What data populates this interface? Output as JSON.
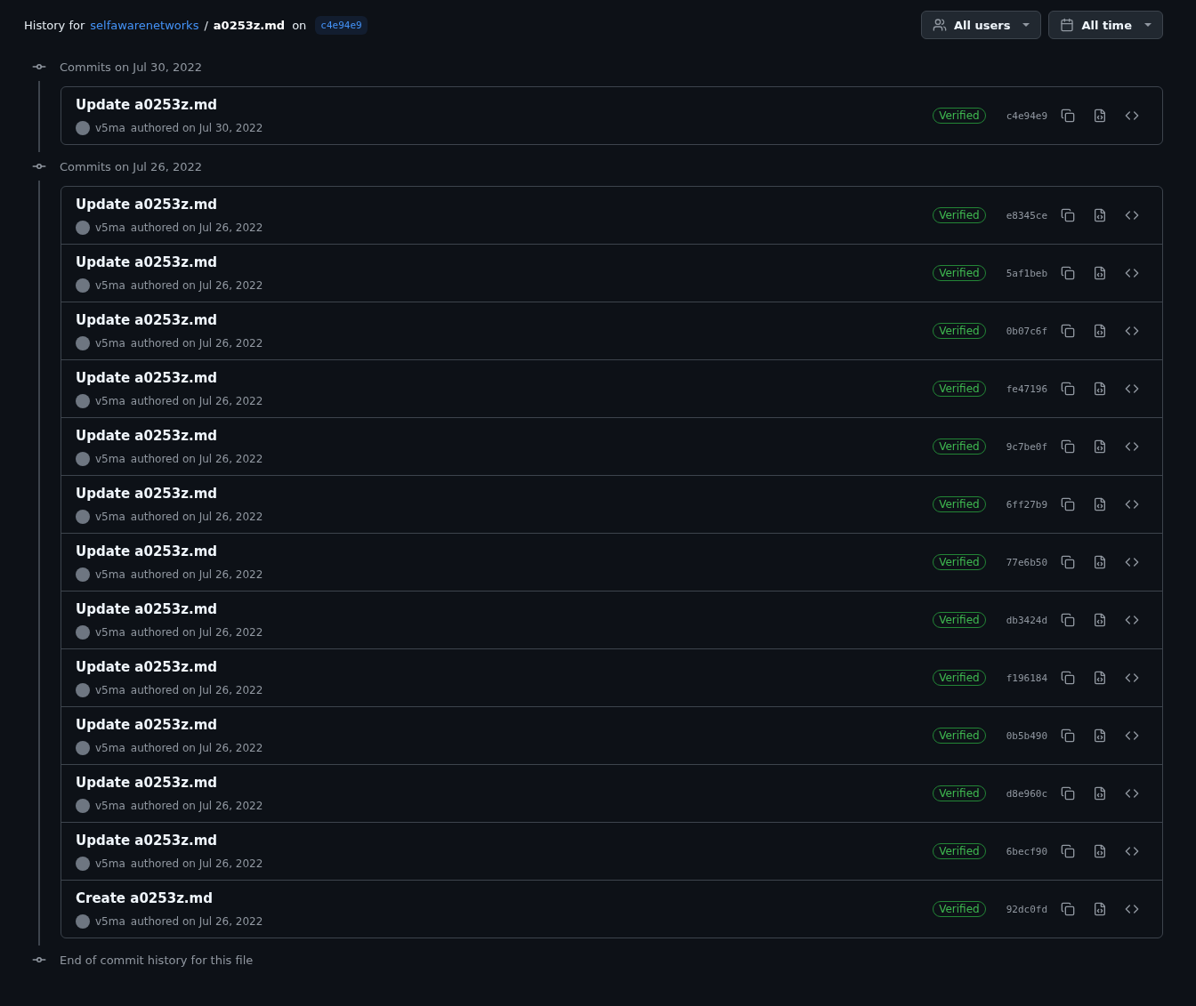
{
  "header": {
    "prefix": "History for",
    "repo": "selfawarenetworks",
    "separator": "/",
    "file": "a0253z.md",
    "on": "on",
    "ref": "c4e94e9"
  },
  "filters": [
    {
      "kind": "users",
      "label": "All users"
    },
    {
      "kind": "time",
      "label": "All time"
    }
  ],
  "groups": [
    {
      "heading": "Commits on Jul 30, 2022",
      "commits": [
        {
          "title": "Update a0253z.md",
          "author": "v5ma",
          "byline": "authored on Jul 30, 2022",
          "badge": "Verified",
          "sha": "c4e94e9"
        }
      ]
    },
    {
      "heading": "Commits on Jul 26, 2022",
      "commits": [
        {
          "title": "Update a0253z.md",
          "author": "v5ma",
          "byline": "authored on Jul 26, 2022",
          "badge": "Verified",
          "sha": "e8345ce"
        },
        {
          "title": "Update a0253z.md",
          "author": "v5ma",
          "byline": "authored on Jul 26, 2022",
          "badge": "Verified",
          "sha": "5af1beb"
        },
        {
          "title": "Update a0253z.md",
          "author": "v5ma",
          "byline": "authored on Jul 26, 2022",
          "badge": "Verified",
          "sha": "0b07c6f"
        },
        {
          "title": "Update a0253z.md",
          "author": "v5ma",
          "byline": "authored on Jul 26, 2022",
          "badge": "Verified",
          "sha": "fe47196"
        },
        {
          "title": "Update a0253z.md",
          "author": "v5ma",
          "byline": "authored on Jul 26, 2022",
          "badge": "Verified",
          "sha": "9c7be0f"
        },
        {
          "title": "Update a0253z.md",
          "author": "v5ma",
          "byline": "authored on Jul 26, 2022",
          "badge": "Verified",
          "sha": "6ff27b9"
        },
        {
          "title": "Update a0253z.md",
          "author": "v5ma",
          "byline": "authored on Jul 26, 2022",
          "badge": "Verified",
          "sha": "77e6b50"
        },
        {
          "title": "Update a0253z.md",
          "author": "v5ma",
          "byline": "authored on Jul 26, 2022",
          "badge": "Verified",
          "sha": "db3424d"
        },
        {
          "title": "Update a0253z.md",
          "author": "v5ma",
          "byline": "authored on Jul 26, 2022",
          "badge": "Verified",
          "sha": "f196184"
        },
        {
          "title": "Update a0253z.md",
          "author": "v5ma",
          "byline": "authored on Jul 26, 2022",
          "badge": "Verified",
          "sha": "0b5b490"
        },
        {
          "title": "Update a0253z.md",
          "author": "v5ma",
          "byline": "authored on Jul 26, 2022",
          "badge": "Verified",
          "sha": "d8e960c"
        },
        {
          "title": "Update a0253z.md",
          "author": "v5ma",
          "byline": "authored on Jul 26, 2022",
          "badge": "Verified",
          "sha": "6becf90"
        },
        {
          "title": "Create a0253z.md",
          "author": "v5ma",
          "byline": "authored on Jul 26, 2022",
          "badge": "Verified",
          "sha": "92dc0fd"
        }
      ]
    }
  ],
  "end_note": "End of commit history for this file"
}
